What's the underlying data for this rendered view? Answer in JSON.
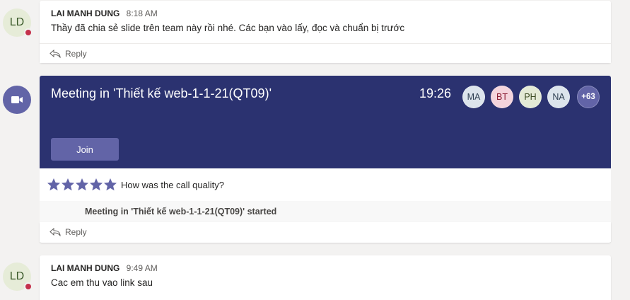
{
  "message1": {
    "avatar_initials": "LD",
    "author": "LAI MANH DUNG",
    "time": "8:18 AM",
    "text": "Thầy đã chia sẻ slide trên team này rồi nhé. Các bạn vào lấy, đọc và chuẩn bị trước",
    "reply_label": "Reply"
  },
  "meeting": {
    "icon": "video-camera-icon",
    "title": "Meeting in 'Thiết kế web-1-1-21(QT09)'",
    "timer": "19:26",
    "participants": [
      {
        "initials": "MA",
        "bg": "#dce4ec",
        "color": "#2d3e50"
      },
      {
        "initials": "BT",
        "bg": "#f4d4dc",
        "color": "#8a1c32"
      },
      {
        "initials": "PH",
        "bg": "#e4ead6",
        "color": "#3b4a22"
      },
      {
        "initials": "NA",
        "bg": "#dce4ec",
        "color": "#2d3e50"
      }
    ],
    "overflow_count": "+63",
    "join_label": "Join",
    "rating_prompt": "How was the call quality?",
    "started_text": "Meeting in 'Thiết kế web-1-1-21(QT09)' started",
    "reply_label": "Reply",
    "colors": {
      "banner": "#2b3270",
      "accent": "#6264a7"
    }
  },
  "message2": {
    "avatar_initials": "LD",
    "author": "LAI MANH DUNG",
    "time": "9:49 AM",
    "text": "Cac em thu vao link sau"
  }
}
